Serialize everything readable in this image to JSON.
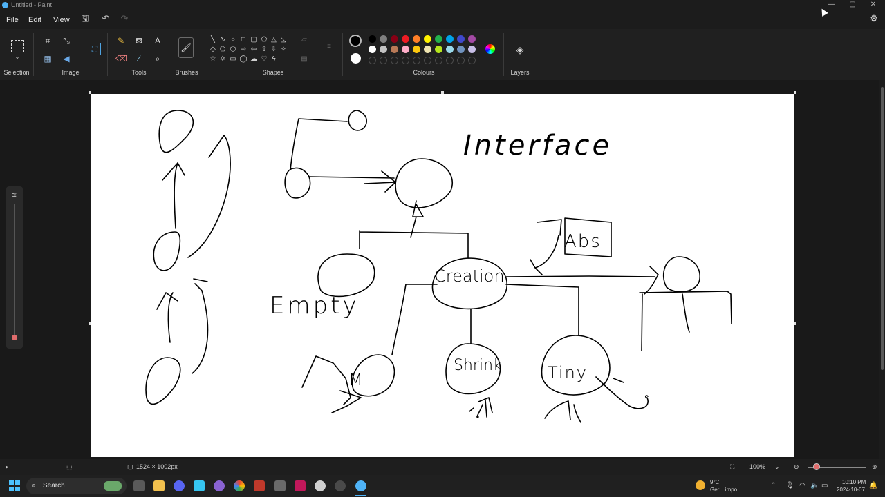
{
  "window": {
    "title": "Untitled - Paint"
  },
  "menu": {
    "file": "File",
    "edit": "Edit",
    "view": "View"
  },
  "ribbon": {
    "groups": {
      "selection": "Selection",
      "image": "Image",
      "tools": "Tools",
      "brushes": "Brushes",
      "shapes": "Shapes",
      "colours": "Colours",
      "layers": "Layers"
    },
    "palette_row1": [
      "#000000",
      "#7f7f7f",
      "#880015",
      "#ed1c24",
      "#ff7f27",
      "#fff200",
      "#22b14c",
      "#00a2e8",
      "#3f48cc",
      "#a349a4"
    ],
    "palette_row2": [
      "#ffffff",
      "#c3c3c3",
      "#b97a57",
      "#ffaec9",
      "#ffc90e",
      "#efe4b0",
      "#b5e61d",
      "#99d9ea",
      "#7092be",
      "#c8bfe7"
    ],
    "primary_colour": "#000000",
    "secondary_colour": "#ffffff"
  },
  "status": {
    "canvas_size": "1524 × 1002px",
    "zoom": "100%"
  },
  "taskbar": {
    "search": "Search",
    "weather_temp": "9°C",
    "weather_desc": "Ger. Limpo",
    "time": "10:10 PM",
    "date": "2024-10-07"
  },
  "drawing": {
    "words": {
      "interface": "Interface",
      "abs": "Abs",
      "creation": "Creation",
      "empty": "Empty",
      "shrink": "Shrink",
      "tiny": "Tiny",
      "mid": "M"
    }
  }
}
